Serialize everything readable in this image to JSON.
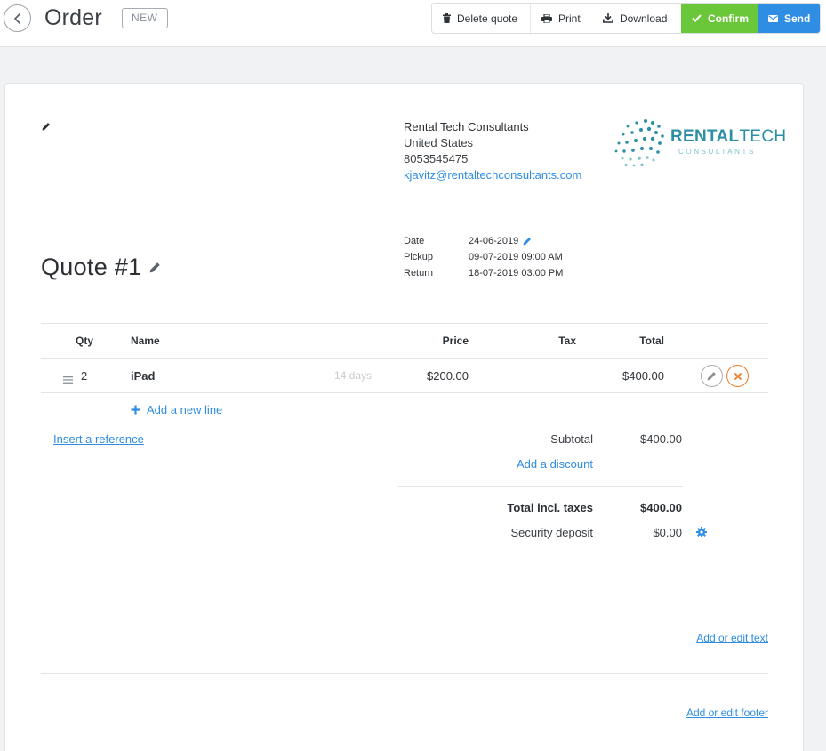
{
  "header": {
    "title": "Order",
    "status_badge": "NEW",
    "buttons": {
      "delete": "Delete quote",
      "print": "Print",
      "download": "Download",
      "confirm": "Confirm",
      "send": "Send"
    }
  },
  "company": {
    "name": "Rental Tech Consultants",
    "country": "United States",
    "phone": "8053545475",
    "email": "kjavitz@rentaltechconsultants.com"
  },
  "logo": {
    "word_bold": "RENTAL",
    "word_light": "TECH",
    "subtitle": "CONSULTANTS",
    "color": "#2c8fa6"
  },
  "dates": {
    "date_label": "Date",
    "date_value": "24-06-2019",
    "pickup_label": "Pickup",
    "pickup_value": "09-07-2019 09:00 AM",
    "return_label": "Return",
    "return_value": "18-07-2019 03:00 PM"
  },
  "quote": {
    "title": "Quote #1"
  },
  "table": {
    "headers": {
      "qty": "Qty",
      "name": "Name",
      "price": "Price",
      "tax": "Tax",
      "total": "Total"
    },
    "rows": [
      {
        "qty": "2",
        "name": "iPad",
        "duration": "14 days",
        "price": "$200.00",
        "tax": "",
        "total": "$400.00"
      }
    ],
    "add_line": "Add a new line"
  },
  "links": {
    "insert_reference": "Insert a reference",
    "add_discount": "Add a discount",
    "add_edit_text": "Add or edit text",
    "add_edit_footer": "Add or edit footer"
  },
  "totals": {
    "subtotal_label": "Subtotal",
    "subtotal_value": "$400.00",
    "total_label": "Total incl. taxes",
    "total_value": "$400.00",
    "deposit_label": "Security deposit",
    "deposit_value": "$0.00"
  },
  "colors": {
    "primary_blue": "#2f8de4",
    "confirm_green": "#6bc73a",
    "remove_orange": "#ee7b27"
  },
  "icons": [
    "chevron-left-icon",
    "trash-icon",
    "printer-icon",
    "download-icon",
    "check-icon",
    "envelope-icon",
    "pencil-icon",
    "drag-handle-icon",
    "close-icon",
    "plus-icon",
    "gear-icon"
  ]
}
